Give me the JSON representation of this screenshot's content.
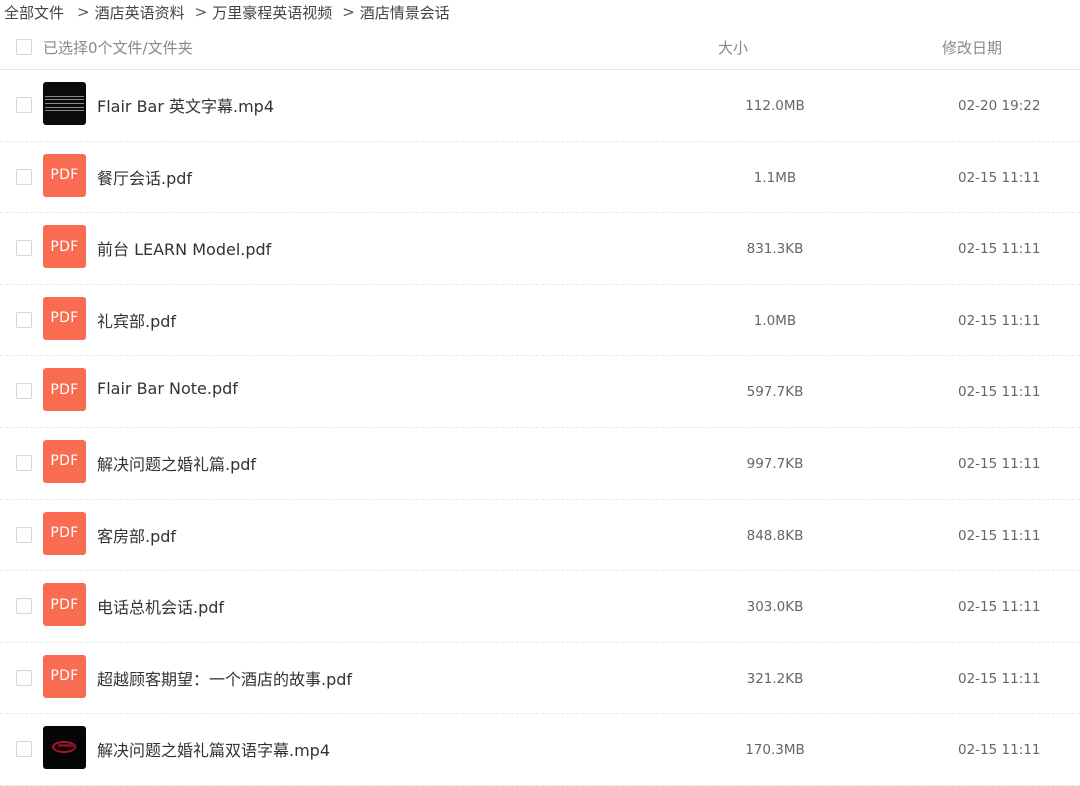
{
  "breadcrumb": [
    {
      "label": "全部文件"
    },
    {
      "label": "酒店英语资料"
    },
    {
      "label": "万里豪程英语视频"
    },
    {
      "label": "酒店情景会话"
    }
  ],
  "breadcrumb_separator": ">",
  "header": {
    "select_label": "已选择0个文件/文件夹",
    "col_size": "大小",
    "col_date": "修改日期"
  },
  "files": [
    {
      "name": "Flair Bar 英文字幕.mp4",
      "size": "112.0MB",
      "date": "02-20 19:22",
      "type": "video",
      "thumb_icon": "video-thumbnail-icon"
    },
    {
      "name": "餐厅会话.pdf",
      "size": "1.1MB",
      "date": "02-15 11:11",
      "type": "pdf",
      "badge": "PDF"
    },
    {
      "name": "前台 LEARN Model.pdf",
      "size": "831.3KB",
      "date": "02-15 11:11",
      "type": "pdf",
      "badge": "PDF"
    },
    {
      "name": "礼宾部.pdf",
      "size": "1.0MB",
      "date": "02-15 11:11",
      "type": "pdf",
      "badge": "PDF"
    },
    {
      "name": "Flair Bar Note.pdf",
      "size": "597.7KB",
      "date": "02-15 11:11",
      "type": "pdf",
      "badge": "PDF"
    },
    {
      "name": "解决问题之婚礼篇.pdf",
      "size": "997.7KB",
      "date": "02-15 11:11",
      "type": "pdf",
      "badge": "PDF"
    },
    {
      "name": "客房部.pdf",
      "size": "848.8KB",
      "date": "02-15 11:11",
      "type": "pdf",
      "badge": "PDF"
    },
    {
      "name": "电话总机会话.pdf",
      "size": "303.0KB",
      "date": "02-15 11:11",
      "type": "pdf",
      "badge": "PDF"
    },
    {
      "name": "超越顾客期望：一个酒店的故事.pdf",
      "size": "321.2KB",
      "date": "02-15 11:11",
      "type": "pdf",
      "badge": "PDF"
    },
    {
      "name": "解决问题之婚礼篇双语字幕.mp4",
      "size": "170.3MB",
      "date": "02-15 11:11",
      "type": "video",
      "thumb_icon": "video-thumbnail-icon"
    }
  ],
  "colors": {
    "pdf_badge": "#f96c51",
    "divider": "#e8e8e8",
    "muted_text": "#888888"
  }
}
